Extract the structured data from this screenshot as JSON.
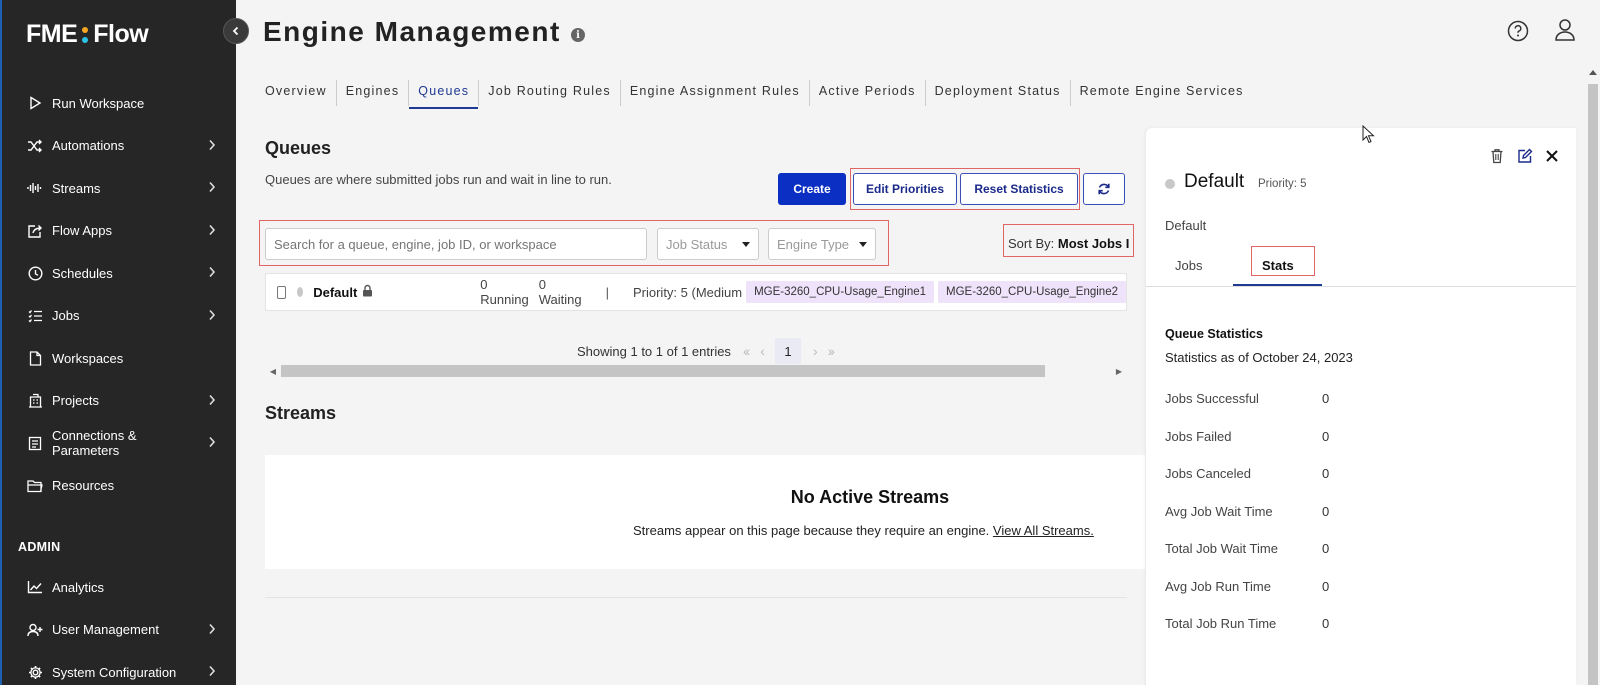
{
  "app": {
    "logo_left": "FME",
    "logo_right": "Flow",
    "logo_dot_colors": [
      "#f5a623",
      "#2cc3e8"
    ]
  },
  "sidebar": {
    "items": [
      {
        "label": "Run Workspace",
        "icon": "play-icon",
        "has_children": false
      },
      {
        "label": "Automations",
        "icon": "shuffle-icon",
        "has_children": true
      },
      {
        "label": "Streams",
        "icon": "wave-icon",
        "has_children": true
      },
      {
        "label": "Flow Apps",
        "icon": "share-icon",
        "has_children": true
      },
      {
        "label": "Schedules",
        "icon": "clock-icon",
        "has_children": true
      },
      {
        "label": "Jobs",
        "icon": "list-icon",
        "has_children": true
      },
      {
        "label": "Workspaces",
        "icon": "file-icon",
        "has_children": false
      },
      {
        "label": "Projects",
        "icon": "building-icon",
        "has_children": true
      },
      {
        "label": "Connections & Parameters",
        "icon": "connections-icon",
        "has_children": true
      },
      {
        "label": "Resources",
        "icon": "folder-icon",
        "has_children": false
      }
    ],
    "admin_label": "ADMIN",
    "admin_items": [
      {
        "label": "Analytics",
        "icon": "chart-icon",
        "has_children": false
      },
      {
        "label": "User Management",
        "icon": "user-add-icon",
        "has_children": true
      },
      {
        "label": "System Configuration",
        "icon": "gear-icon",
        "has_children": true
      }
    ]
  },
  "header": {
    "title": "Engine Management"
  },
  "tabs": [
    {
      "label": "Overview",
      "active": false
    },
    {
      "label": "Engines",
      "active": false
    },
    {
      "label": "Queues",
      "active": true
    },
    {
      "label": "Job Routing Rules",
      "active": false
    },
    {
      "label": "Engine Assignment Rules",
      "active": false
    },
    {
      "label": "Active Periods",
      "active": false
    },
    {
      "label": "Deployment Status",
      "active": false
    },
    {
      "label": "Remote Engine Services",
      "active": false
    }
  ],
  "queues": {
    "title": "Queues",
    "description": "Queues are where submitted jobs run and wait in line to run.",
    "create_label": "Create",
    "edit_priorities_label": "Edit Priorities",
    "reset_statistics_label": "Reset Statistics",
    "search_placeholder": "Search for a queue, engine, job ID, or workspace",
    "job_status_placeholder": "Job Status",
    "engine_type_placeholder": "Engine Type",
    "sort_by_label": "Sort By:",
    "sort_by_value": "Most Jobs I",
    "row": {
      "name": "Default",
      "running": "0 Running",
      "waiting": "0 Waiting",
      "separator": "|",
      "priority": "Priority: 5 (Medium",
      "engines": [
        "MGE-3260_CPU-Usage_Engine1",
        "MGE-3260_CPU-Usage_Engine2"
      ]
    },
    "pagination": {
      "summary": "Showing 1 to 1 of 1 entries",
      "current_page": "1"
    }
  },
  "streams": {
    "title": "Streams",
    "empty_title": "No Active Streams",
    "empty_desc": "Streams appear on this page because they require an engine.",
    "view_all_link": "View All Streams."
  },
  "panel": {
    "title": "Default",
    "priority": "Priority: 5",
    "subtitle": "Default",
    "tab_jobs": "Jobs",
    "tab_stats": "Stats",
    "stats_title": "Queue Statistics",
    "stats_as_of": "Statistics as of October 24, 2023",
    "stats": [
      {
        "label": "Jobs Successful",
        "value": "0"
      },
      {
        "label": "Jobs Failed",
        "value": "0"
      },
      {
        "label": "Jobs Canceled",
        "value": "0"
      },
      {
        "label": "Avg Job Wait Time",
        "value": "0"
      },
      {
        "label": "Total Job Wait Time",
        "value": "0"
      },
      {
        "label": "Avg Job Run Time",
        "value": "0"
      },
      {
        "label": "Total Job Run Time",
        "value": "0"
      }
    ]
  },
  "colors": {
    "primary": "#0b2fc3",
    "sidebar_bg": "#262626",
    "highlight": "#e06666",
    "engine_chip": "#efe3fb"
  }
}
